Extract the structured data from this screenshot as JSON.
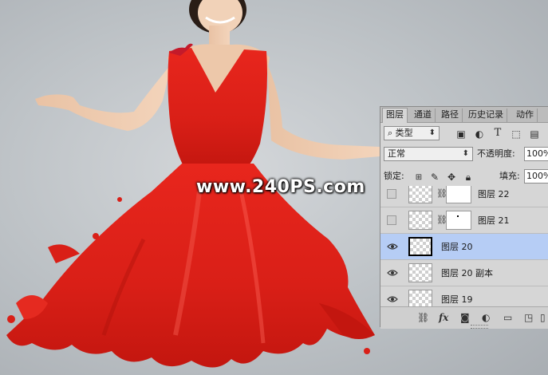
{
  "watermark": "www.240PS.com",
  "panel": {
    "tabs": [
      {
        "label": "图层",
        "active": true
      },
      {
        "label": "通道",
        "active": false
      },
      {
        "label": "路径",
        "active": false
      },
      {
        "label": "历史记录",
        "active": false
      },
      {
        "label": "动作",
        "active": false
      }
    ],
    "filter": {
      "selected": "类型",
      "search_icon": "search-icon"
    },
    "filter_icons": [
      "image-filter-icon",
      "adjustment-filter-icon",
      "type-filter-icon",
      "shape-filter-icon",
      "smart-object-filter-icon"
    ],
    "blend_mode": "正常",
    "opacity_label": "不透明度:",
    "opacity_value": "100%",
    "lock_label": "锁定:",
    "fill_label": "填充:",
    "fill_value": "100%",
    "layers": [
      {
        "name": "图层 22",
        "visible": false,
        "has_mask": true,
        "selected": false
      },
      {
        "name": "图层 21",
        "visible": false,
        "has_mask": true,
        "selected": false
      },
      {
        "name": "图层 20",
        "visible": true,
        "has_mask": false,
        "selected": true
      },
      {
        "name": "图层 20 副本",
        "visible": true,
        "has_mask": false,
        "selected": false
      },
      {
        "name": "图层 19",
        "visible": true,
        "has_mask": false,
        "selected": false
      }
    ],
    "bottom_icons": [
      "link-layers-icon",
      "fx-icon",
      "add-mask-icon",
      "adjustment-layer-icon",
      "new-group-icon",
      "new-layer-icon",
      "delete-layer-icon"
    ],
    "fx_label": "fx"
  },
  "colors": {
    "dress": "#e0231c",
    "selection": "#b6cdf5"
  }
}
